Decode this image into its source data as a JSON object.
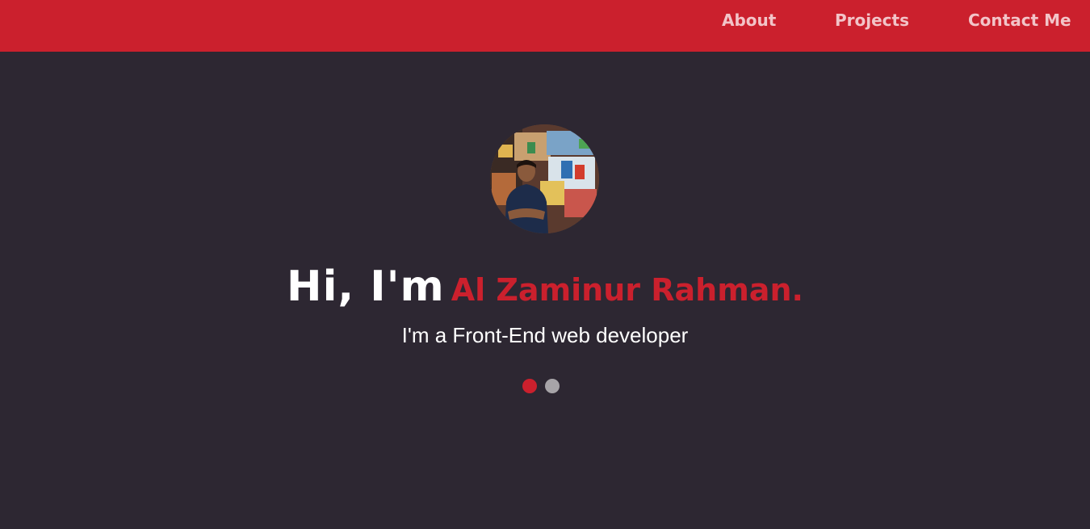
{
  "nav": {
    "about": "About",
    "projects": "Projects",
    "contact": "Contact Me"
  },
  "hero": {
    "greeting": "Hi, I'm",
    "name": "Al Zaminur Rahman.",
    "subtitle": "I'm a Front-End web developer"
  },
  "carousel": {
    "slides": 2,
    "active": 1
  },
  "colors": {
    "brand": "#cb202d",
    "background": "#2d2732",
    "inactive_dot": "#a7a4a8"
  }
}
